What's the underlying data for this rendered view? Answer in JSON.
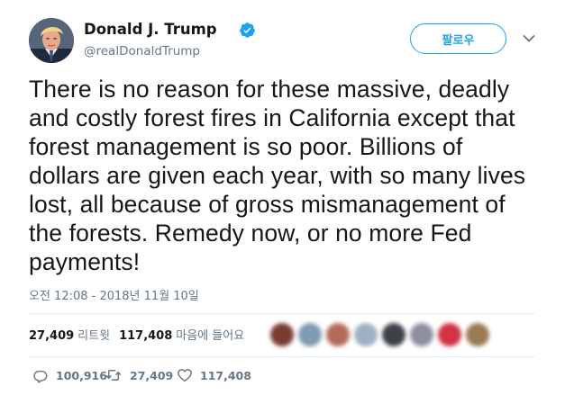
{
  "user": {
    "name": "Donald J. Trump",
    "handle": "@realDonaldTrump"
  },
  "follow_label": "팔로우",
  "tweet": {
    "text_lines": [
      "There is no reason for these massive, deadly",
      "and costly forest fires in California except that",
      "forest management is so poor. Billions of",
      "dollars are given each year, with so many lives",
      "lost, all because of gross mismanagement of",
      "the forests. Remedy now, or no more Fed",
      "payments!"
    ],
    "timestamp": "오전 12:08 - 2018년 11월 10일"
  },
  "stats": {
    "retweets_count": "27,409",
    "retweets_label": "리트윗",
    "likes_count": "117,408",
    "likes_label": "마음에 들어요"
  },
  "actions": {
    "replies": "100,916",
    "retweets": "27,409",
    "likes": "117,408"
  },
  "colors": {
    "accent": "#1da1f2",
    "secondary_text": "#657786",
    "divider": "#e6ecf0"
  },
  "icons": [
    "verified-badge-icon",
    "chevron-down-icon",
    "reply-icon",
    "retweet-icon",
    "like-icon"
  ]
}
